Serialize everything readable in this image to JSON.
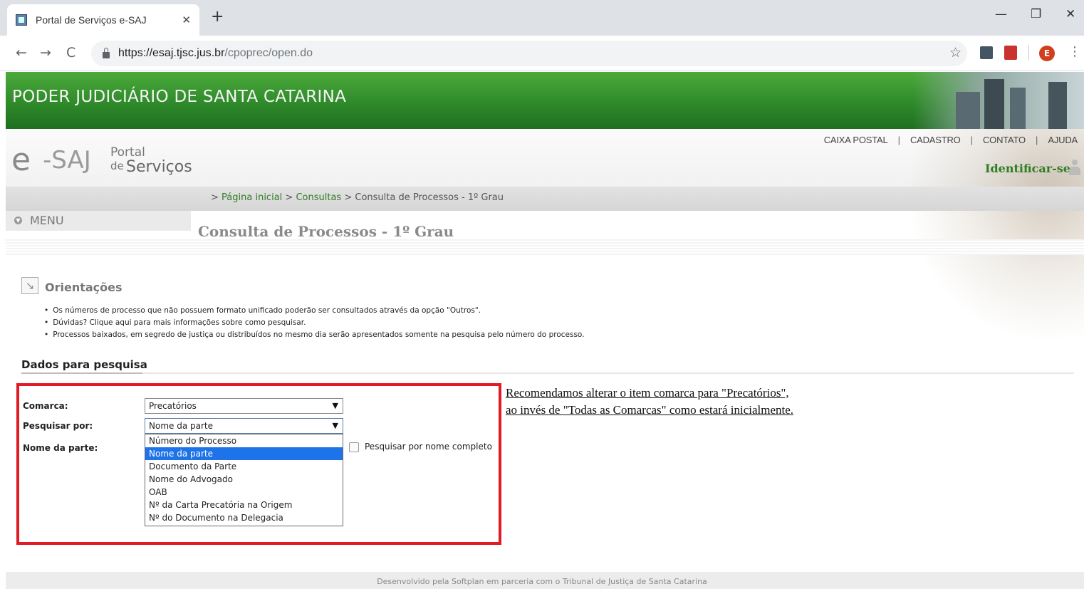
{
  "browser": {
    "tab_title": "Portal de Serviços e-SAJ",
    "url_host": "https://esaj.tjsc.jus.br",
    "url_path": "/cpoprec/open.do",
    "avatar_letter": "E"
  },
  "site": {
    "banner_title": "PODER JUDICIÁRIO DE SANTA CATARINA",
    "logo_e": "e",
    "logo_saj": "-SAJ",
    "logo_portal": "Portal",
    "logo_de": "de",
    "logo_servicos": "Serviços",
    "top_links": [
      "CAIXA POSTAL",
      "CADASTRO",
      "CONTATO",
      "AJUDA"
    ],
    "identify_label": "Identificar-se",
    "menu_label": "MENU",
    "breadcrumb": {
      "prefix": ">",
      "home": "Página inicial",
      "consultas": "Consultas",
      "current": "Consulta de Processos - 1º Grau"
    },
    "page_title": "Consulta de Processos - 1º Grau"
  },
  "orientacoes": {
    "title": "Orientações",
    "items": [
      "Os números de processo que não possuem formato unificado poderão ser consultados através da opção \"Outros\".",
      "Dúvidas? Clique aqui para mais informações sobre como pesquisar.",
      "Processos baixados, em segredo de justiça ou distribuídos no mesmo dia serão apresentados somente na pesquisa pelo número do processo."
    ]
  },
  "form": {
    "section_title": "Dados para pesquisa",
    "comarca_label": "Comarca:",
    "comarca_value": "Precatórios",
    "pesquisar_label": "Pesquisar por:",
    "pesquisar_value": "Nome da parte",
    "nome_label": "Nome da parte:",
    "dropdown_options": [
      "Número do Processo",
      "Nome da parte",
      "Documento da Parte",
      "Nome do Advogado",
      "OAB",
      "Nº da Carta Precatória na Origem",
      "Nº do Documento na Delegacia"
    ],
    "selected_option": "Nome da parte",
    "checkbox_label": "Pesquisar por nome completo"
  },
  "note": {
    "line1": "Recomendamos alterar o item comarca para \"Precatórios\",",
    "line2": "ao invés de \"Todas as Comarcas\" como estará inicialmente."
  },
  "footer": {
    "text": "Desenvolvido pela Softplan em parceria com o Tribunal de Justiça de Santa Catarina"
  },
  "colors": {
    "banner_green": "#2f8a2a",
    "link_green": "#2f7d23",
    "highlight_red": "#e01b24",
    "selection_blue": "#1e73e8"
  }
}
